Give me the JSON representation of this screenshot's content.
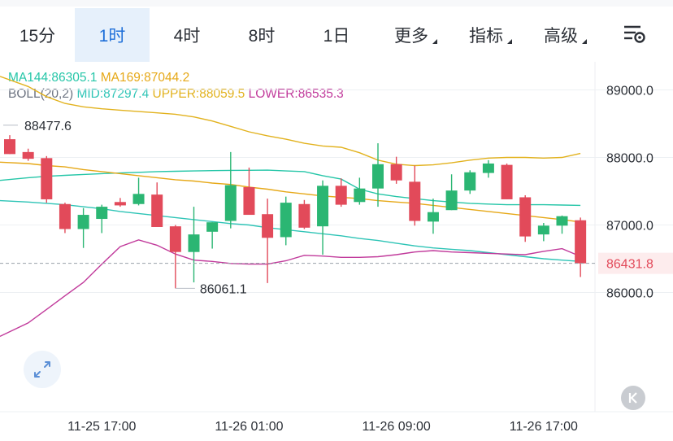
{
  "toolbar": {
    "tabs": [
      {
        "label": "15分",
        "dropdown": false
      },
      {
        "label": "1时",
        "dropdown": false,
        "active": true
      },
      {
        "label": "4时",
        "dropdown": false
      },
      {
        "label": "8时",
        "dropdown": false
      },
      {
        "label": "1日",
        "dropdown": false
      },
      {
        "label": "更多",
        "dropdown": true
      },
      {
        "label": "指标",
        "dropdown": true
      },
      {
        "label": "高级",
        "dropdown": true
      }
    ],
    "settings_icon": "chart-settings-icon"
  },
  "legend": {
    "ma144": "MA144:86305.1",
    "ma169": "MA169:87044.2",
    "boll_name": "BOLL(20,2)",
    "boll_mid": "MID:87297.4",
    "boll_upper": "UPPER:88059.5",
    "boll_lower": "LOWER:86535.3"
  },
  "colors": {
    "up": "#2bb673",
    "down": "#e24a5a",
    "ma144": "#26c6a8",
    "ma169": "#e6a817",
    "boll_mid": "#2ec4b6",
    "boll_upper": "#e2b21e",
    "boll_lower": "#c13a9b",
    "boll_name": "#6b7280",
    "axis_text": "#2b2f36",
    "price_tag_bg": "#fdeced",
    "price_tag_text": "#e24a5a"
  },
  "annotations": {
    "high": "88477.6",
    "low": "86061.1"
  },
  "chart_data": {
    "type": "candlestick",
    "ylim": [
      85200,
      89700
    ],
    "y_ticks": [
      86000,
      87000,
      88000,
      89000
    ],
    "y_tick_labels": [
      "86000.0",
      "87000.0",
      "88000.0",
      "89000.0"
    ],
    "x_tick_labels": [
      "11-25 17:00",
      "11-26 01:00",
      "11-26 09:00",
      "11-26 17:00"
    ],
    "x_tick_index": [
      5,
      13,
      21,
      29
    ],
    "last_price": 86431.8,
    "last_price_label": "86431.8",
    "candles": [
      {
        "o": 88270,
        "h": 88330,
        "l": 88050,
        "c": 88050
      },
      {
        "o": 88080,
        "h": 88130,
        "l": 87950,
        "c": 87980
      },
      {
        "o": 87990,
        "h": 88020,
        "l": 87330,
        "c": 87380
      },
      {
        "o": 87310,
        "h": 87330,
        "l": 86880,
        "c": 86940
      },
      {
        "o": 86940,
        "h": 87250,
        "l": 86660,
        "c": 87150
      },
      {
        "o": 87090,
        "h": 87300,
        "l": 86880,
        "c": 87270
      },
      {
        "o": 87340,
        "h": 87400,
        "l": 87270,
        "c": 87290
      },
      {
        "o": 87310,
        "h": 87700,
        "l": 87290,
        "c": 87460
      },
      {
        "o": 87450,
        "h": 87630,
        "l": 86990,
        "c": 86970
      },
      {
        "o": 86980,
        "h": 87000,
        "l": 86061.1,
        "c": 86600
      },
      {
        "o": 86600,
        "h": 87270,
        "l": 86150,
        "c": 86860
      },
      {
        "o": 86900,
        "h": 87040,
        "l": 86650,
        "c": 87040
      },
      {
        "o": 87060,
        "h": 88080,
        "l": 86950,
        "c": 87590
      },
      {
        "o": 87560,
        "h": 87850,
        "l": 87160,
        "c": 87150
      },
      {
        "o": 87160,
        "h": 87390,
        "l": 86140,
        "c": 86810
      },
      {
        "o": 86820,
        "h": 87420,
        "l": 86700,
        "c": 87330
      },
      {
        "o": 87310,
        "h": 87370,
        "l": 86940,
        "c": 86960
      },
      {
        "o": 86980,
        "h": 87660,
        "l": 86560,
        "c": 87580
      },
      {
        "o": 87580,
        "h": 87690,
        "l": 87270,
        "c": 87300
      },
      {
        "o": 87340,
        "h": 87700,
        "l": 87300,
        "c": 87540
      },
      {
        "o": 87540,
        "h": 88210,
        "l": 87270,
        "c": 87900
      },
      {
        "o": 87900,
        "h": 88010,
        "l": 87610,
        "c": 87660
      },
      {
        "o": 87640,
        "h": 87880,
        "l": 86990,
        "c": 87060
      },
      {
        "o": 87050,
        "h": 87390,
        "l": 86870,
        "c": 87190
      },
      {
        "o": 87220,
        "h": 87750,
        "l": 87220,
        "c": 87510
      },
      {
        "o": 87510,
        "h": 87810,
        "l": 87460,
        "c": 87780
      },
      {
        "o": 87770,
        "h": 87960,
        "l": 87700,
        "c": 87910
      },
      {
        "o": 87890,
        "h": 87910,
        "l": 87380,
        "c": 87380
      },
      {
        "o": 87410,
        "h": 87440,
        "l": 86750,
        "c": 86830
      },
      {
        "o": 86860,
        "h": 87030,
        "l": 86760,
        "c": 86990
      },
      {
        "o": 86990,
        "h": 87140,
        "l": 86870,
        "c": 87130
      },
      {
        "o": 87070,
        "h": 87110,
        "l": 86230,
        "c": 86431.8
      }
    ],
    "series": [
      {
        "name": "MA144",
        "values": [
          87660,
          87700,
          87720,
          87735,
          87748,
          87760,
          87770,
          87780,
          87790,
          87795,
          87800,
          87805,
          87808,
          87810,
          87812,
          87800,
          87790,
          87730,
          87680,
          87530,
          87460,
          87420,
          87390,
          87360,
          87340,
          87320,
          87310,
          87300,
          87300,
          87300,
          87295,
          87290
        ]
      },
      {
        "name": "MA169",
        "values": [
          87930,
          87910,
          87880,
          87860,
          87820,
          87790,
          87760,
          87730,
          87700,
          87670,
          87650,
          87620,
          87600,
          87560,
          87530,
          87490,
          87460,
          87430,
          87410,
          87390,
          87360,
          87340,
          87320,
          87290,
          87260,
          87230,
          87200,
          87170,
          87140,
          87110,
          87080,
          87044.2
        ]
      },
      {
        "name": "MID",
        "values": [
          87360,
          87340,
          87320,
          87300,
          87270,
          87240,
          87200,
          87170,
          87140,
          87110,
          87080,
          87050,
          87020,
          87000,
          86960,
          86930,
          86900,
          86870,
          86840,
          86800,
          86770,
          86730,
          86690,
          86660,
          86640,
          86620,
          86590,
          86560,
          86530,
          86500,
          86480,
          86460
        ]
      },
      {
        "name": "UPPER",
        "values": [
          89200,
          89050,
          88900,
          88800,
          88750,
          88720,
          88700,
          88680,
          88660,
          88640,
          88600,
          88540,
          88460,
          88380,
          88320,
          88270,
          88210,
          88170,
          88150,
          88070,
          87960,
          87900,
          87880,
          87890,
          87920,
          87960,
          87990,
          88000,
          88000,
          87990,
          88000,
          88059.5
        ]
      },
      {
        "name": "LOWER",
        "values": [
          85350,
          85550,
          85750,
          85950,
          86150,
          86420,
          86680,
          86780,
          86700,
          86570,
          86480,
          86460,
          86430,
          86420,
          86420,
          86470,
          86550,
          86540,
          86520,
          86520,
          86530,
          86560,
          86600,
          86620,
          86600,
          86590,
          86580,
          86570,
          86560,
          86610,
          86650,
          86535.3
        ]
      }
    ]
  }
}
